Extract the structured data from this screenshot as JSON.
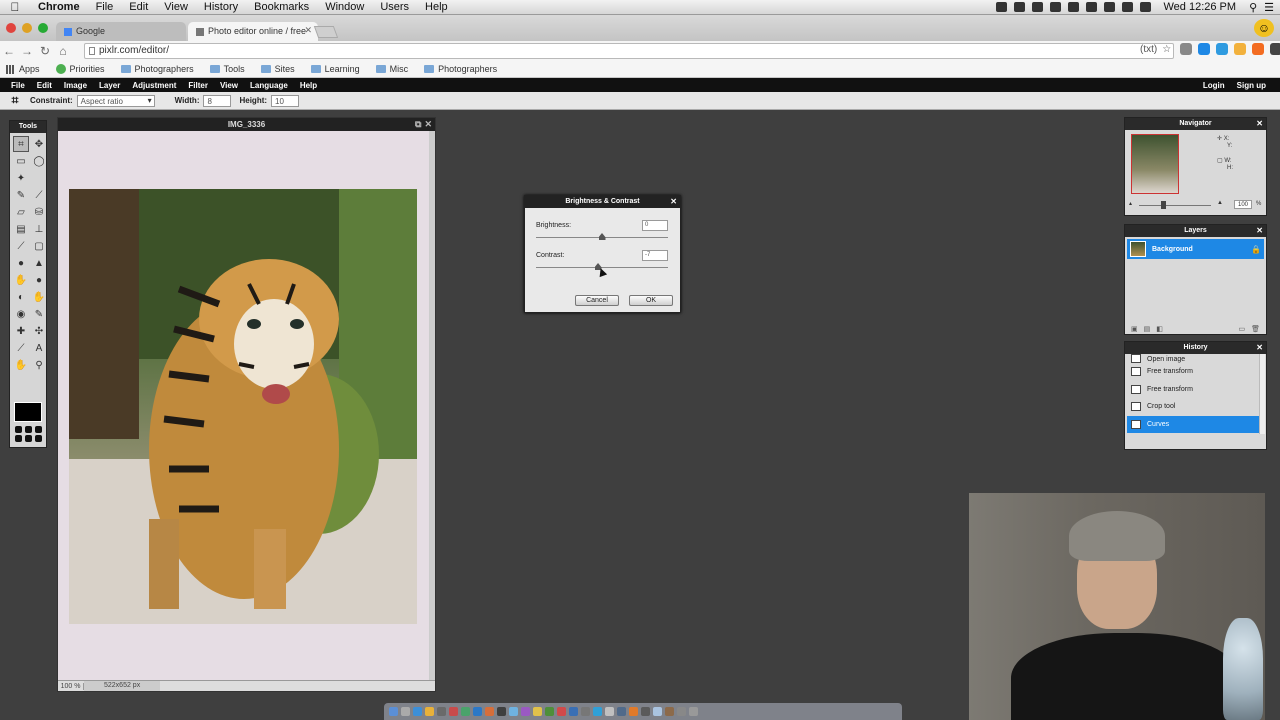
{
  "mac_menu": {
    "app_name": "Chrome",
    "items": [
      "File",
      "Edit",
      "View",
      "History",
      "Bookmarks",
      "Window",
      "Users",
      "Help"
    ],
    "clock": "Wed 12:26 PM"
  },
  "browser": {
    "tabs": [
      {
        "title": "Google",
        "active": false
      },
      {
        "title": "Photo editor online / free",
        "active": true
      }
    ],
    "url": "pixlr.com/editor/",
    "rss_label": "(txt)",
    "bookmarks": [
      "Apps",
      "Priorities",
      "Photographers",
      "Tools",
      "Sites",
      "Learning",
      "Misc",
      "Photographers"
    ]
  },
  "pixlr": {
    "menu": [
      "File",
      "Edit",
      "Image",
      "Layer",
      "Adjustment",
      "Filter",
      "View",
      "Language",
      "Help"
    ],
    "login": "Login",
    "signup": "Sign up",
    "options": {
      "constraint_label": "Constraint:",
      "constraint_value": "Aspect ratio",
      "width_label": "Width:",
      "width_value": "8",
      "height_label": "Height:",
      "height_value": "10"
    },
    "tools_title": "Tools",
    "image_window": {
      "title": "IMG_3336",
      "zoom": "100",
      "zoom_unit": "%",
      "dimensions": "522x652 px"
    },
    "dialog": {
      "title": "Brightness & Contrast",
      "brightness_label": "Brightness:",
      "brightness_value": "0",
      "brightness_level": 0.5,
      "contrast_label": "Contrast:",
      "contrast_value": "-7",
      "contrast_level": 0.47,
      "cancel_label": "Cancel",
      "ok_label": "OK"
    },
    "navigator": {
      "title": "Navigator",
      "x_label": "X:",
      "y_label": "Y:",
      "w_label": "W:",
      "h_label": "H:",
      "zoom_value": "100",
      "zoom_unit": "%"
    },
    "layers": {
      "title": "Layers",
      "items": [
        {
          "name": "Background",
          "selected": true,
          "locked": true
        }
      ]
    },
    "history": {
      "title": "History",
      "items": [
        {
          "label": "Open image",
          "selected": false
        },
        {
          "label": "Free transform",
          "selected": false
        },
        {
          "label": "Free transform",
          "selected": false
        },
        {
          "label": "Crop tool",
          "selected": false
        },
        {
          "label": "Curves",
          "selected": true
        }
      ]
    }
  },
  "colors": {
    "selection_blue": "#1e88e5",
    "workspace_gray": "#3f3f3f",
    "panel_dark": "#222222"
  }
}
